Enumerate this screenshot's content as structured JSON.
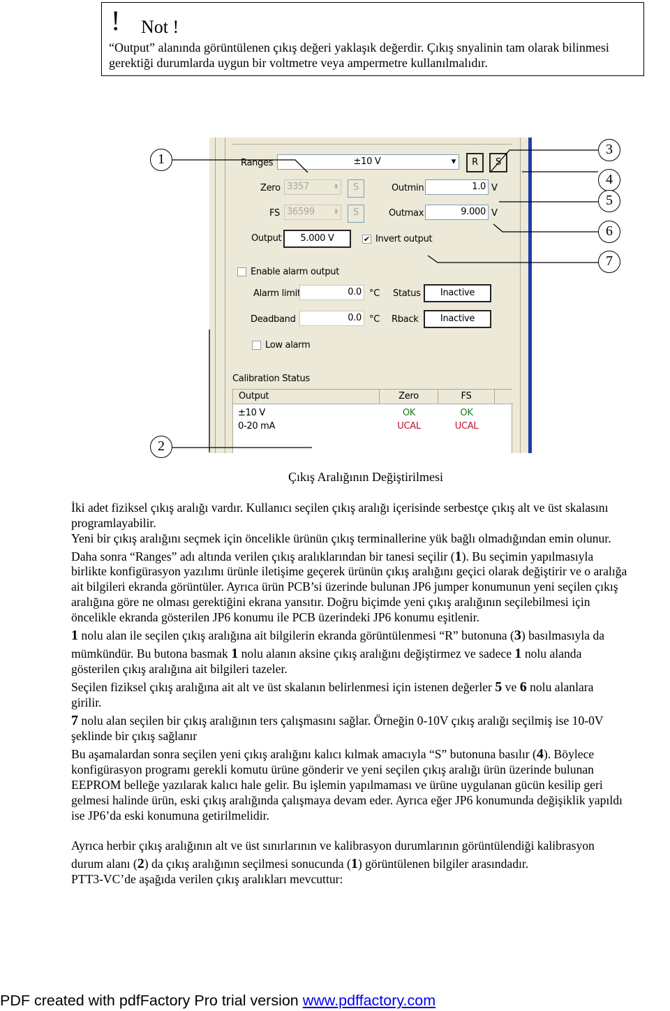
{
  "note": {
    "bang": "!",
    "title": "Not !",
    "lines": [
      "“Output” alanında görüntülenen çıkış değeri yaklaşık değerdir. Çıkış snyalinin tam olarak bilinmesi",
      "gerektiği durumlarda uygun bir voltmetre veya ampermetre kullanılmalıdır."
    ]
  },
  "screenshot": {
    "ranges_label": "Ranges",
    "ranges_value": "±10 V",
    "r_button": "R",
    "s_button": "S",
    "zero_label": "Zero",
    "zero_value": "3357",
    "fs_label": "FS",
    "fs_value": "36599",
    "zero_s": "S",
    "fs_s": "S",
    "outmin_label": "Outmin",
    "outmin_value": "1.0",
    "outmax_label": "Outmax",
    "outmax_value": "9.000",
    "unit_v": "V",
    "output_label": "Output",
    "output_value": "5.000 V",
    "invert_label": "Invert output",
    "invert_checked": true,
    "enable_alarm_label": "Enable alarm output",
    "enable_alarm_checked": false,
    "alarm_limit_label": "Alarm limit",
    "alarm_limit_value": "0.0",
    "deadband_label": "Deadband",
    "deadband_value": "0.0",
    "unit_c": "°C",
    "status_label": "Status",
    "status_value": "Inactive",
    "rback_label": "Rback",
    "rback_value": "Inactive",
    "low_alarm_label": "Low alarm",
    "low_alarm_checked": false,
    "calibration_title": "Calibration Status",
    "table": {
      "headers": [
        "Output",
        "Zero",
        "FS"
      ],
      "rows": [
        {
          "output": "±10 V",
          "zero": "OK",
          "fs": "OK"
        },
        {
          "output": "0-20 mA",
          "zero": "UCAL",
          "fs": "UCAL"
        }
      ]
    },
    "colors": {
      "ok": "#1a7a1a",
      "ucal": "#c0102a",
      "panel": "#ece9d8",
      "border": "#1f3fa8"
    }
  },
  "callouts": [
    "1",
    "2",
    "3",
    "4",
    "5",
    "6",
    "7"
  ],
  "caption": "Çıkış Aralığının Değiştirilmesi",
  "paragraphs": [
    [
      [
        {
          "t": "İki adet fiziksel çıkış aralığı vardır. Kullanıcı seçilen çıkış aralığı içerisinde serbestçe çıkış alt ve üst skalasını"
        }
      ],
      [
        {
          "t": "programlayabilir."
        }
      ]
    ],
    [
      [
        {
          "t": "Yeni bir çıkış aralığını seçmek için öncelikle ürünün çıkış terminallerine yük bağlı olmadığından emin olunur."
        }
      ]
    ],
    [
      [
        {
          "t": "Daha sonra “Ranges” adı altında verilen çıkış aralıklarından bir tanesi seçilir ("
        },
        {
          "t": "1",
          "b": true
        },
        {
          "t": "). Bu seçimin yapılmasıyla"
        }
      ],
      [
        {
          "t": "birlikte konfigürasyon yazılımı ürünle iletişime geçerek ürünün çıkış aralığını geçici olarak değiştirir ve o aralığa"
        }
      ],
      [
        {
          "t": "ait bilgileri ekranda görüntüler. Ayrıca ürün PCB’si üzerinde bulunan JP6 jumper konumunun yeni seçilen çıkış"
        }
      ],
      [
        {
          "t": "aralığına göre ne olması gerektiğini ekrana yansıtır. Doğru biçimde yeni çıkış aralığının seçilebilmesi için"
        }
      ],
      [
        {
          "t": "öncelikle ekranda gösterilen JP6 konumu ile PCB üzerindeki JP6 konumu eşitlenir."
        }
      ]
    ],
    [
      [
        {
          "t": "1",
          "b": true
        },
        {
          "t": " nolu alan ile seçilen çıkış aralığına ait bilgilerin ekranda görüntülenmesi “R” butonuna ("
        },
        {
          "t": "3",
          "b": true
        },
        {
          "t": ") basılmasıyla da"
        }
      ],
      [
        {
          "t": "mümkündür. Bu butona basmak "
        },
        {
          "t": "1",
          "b": true
        },
        {
          "t": " nolu alanın aksine çıkış aralığını değiştirmez ve sadece "
        },
        {
          "t": "1",
          "b": true
        },
        {
          "t": " nolu alanda"
        }
      ],
      [
        {
          "t": "gösterilen çıkış aralığına ait bilgileri tazeler."
        }
      ]
    ],
    [
      [
        {
          "t": "Seçilen fiziksel çıkış aralığına ait alt ve üst skalanın belirlenmesi için istenen değerler "
        },
        {
          "t": "5",
          "b": true
        },
        {
          "t": " ve "
        },
        {
          "t": "6",
          "b": true
        },
        {
          "t": " nolu alanlara"
        }
      ],
      [
        {
          "t": "girilir."
        }
      ]
    ],
    [
      [
        {
          "t": "7",
          "b": true
        },
        {
          "t": " nolu alan seçilen bir çıkış aralığının ters çalışmasını sağlar. Örneğin 0-10V çıkış aralığı seçilmiş ise 10-0V"
        }
      ],
      [
        {
          "t": "şeklinde bir çıkış sağlanır"
        }
      ]
    ],
    [
      [
        {
          "t": "Bu aşamalardan sonra seçilen yeni çıkış aralığını kalıcı kılmak amacıyla “S” butonuna basılır ("
        },
        {
          "t": "4",
          "b": true
        },
        {
          "t": "). Böylece"
        }
      ],
      [
        {
          "t": "konfigürasyon programı gerekli komutu ürüne gönderir ve yeni seçilen çıkış aralığı ürün üzerinde bulunan"
        }
      ],
      [
        {
          "t": "EEPROM belleğe yazılarak kalıcı hale gelir. Bu işlemin yapılmaması ve ürüne uygulanan gücün kesilip geri"
        }
      ],
      [
        {
          "t": "gelmesi halinde ürün, eski çıkış aralığında çalışmaya devam eder. Ayrıca eğer JP6 konumunda değişiklik yapıldı"
        }
      ],
      [
        {
          "t": "ise JP6’da eski konumuna getirilmelidir."
        }
      ]
    ],
    [
      [
        {
          "t": "Ayrıca herbir çıkış aralığının alt ve üst sınırlarının ve kalibrasyon durumlarının görüntülendiği kalibrasyon"
        }
      ],
      [
        {
          "t": "durum alanı ("
        },
        {
          "t": "2",
          "b": true
        },
        {
          "t": ") da çıkış aralığının seçilmesi sonucunda ("
        },
        {
          "t": "1",
          "b": true
        },
        {
          "t": ") görüntülenen bilgiler arasındadır."
        }
      ],
      [
        {
          "t": "PTT3-VC’de aşağıda verilen çıkış aralıkları mevcuttur:"
        }
      ]
    ]
  ],
  "footer": {
    "text": "PDF created with pdfFactory Pro trial version ",
    "link": "www.pdffactory.com"
  }
}
